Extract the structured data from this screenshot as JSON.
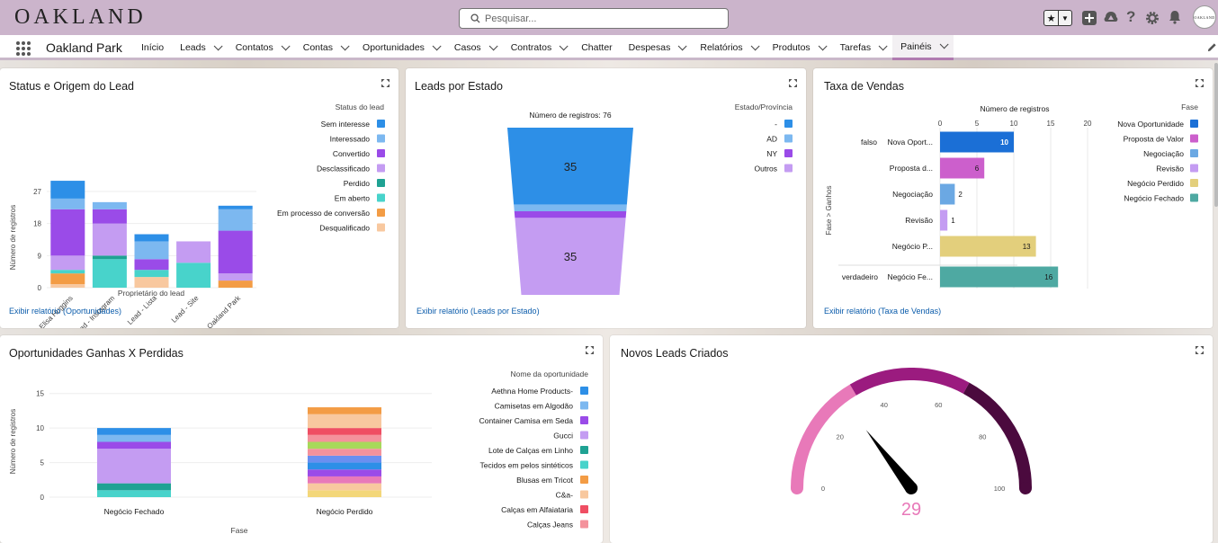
{
  "brand": {
    "logo_text": "OAKLAND",
    "avatar_text": "OAKLAND"
  },
  "search": {
    "placeholder": "Pesquisar..."
  },
  "nav": {
    "app_name": "Oakland Park",
    "items": [
      {
        "label": "Início",
        "chevron": false
      },
      {
        "label": "Leads",
        "chevron": true
      },
      {
        "label": "Contatos",
        "chevron": true
      },
      {
        "label": "Contas",
        "chevron": true
      },
      {
        "label": "Oportunidades",
        "chevron": true
      },
      {
        "label": "Casos",
        "chevron": true
      },
      {
        "label": "Contratos",
        "chevron": true
      },
      {
        "label": "Chatter",
        "chevron": false
      },
      {
        "label": "Despesas",
        "chevron": true
      },
      {
        "label": "Relatórios",
        "chevron": true
      },
      {
        "label": "Produtos",
        "chevron": true
      },
      {
        "label": "Tarefas",
        "chevron": true
      },
      {
        "label": "Painéis",
        "chevron": true,
        "active": true
      }
    ]
  },
  "colors": {
    "topbar": "#cbb4cb",
    "link": "#0b5cab",
    "gauge_pink": "#e879b9",
    "gauge_magenta": "#9b1b7f",
    "gauge_dark": "#4b0a3e"
  },
  "cards": {
    "status_origem": {
      "title": "Status e Origem do Lead",
      "link": "Exibir relatório (Oportunidades)",
      "chart_data": {
        "type": "bar",
        "stacked": true,
        "title": "Status e Origem do Lead",
        "xlabel": "Proprietário do lead",
        "ylabel": "Número de registros",
        "yticks": [
          0,
          9,
          18,
          27
        ],
        "ylim": [
          0,
          28
        ],
        "legend_title": "Status do lead",
        "legend_position": "right",
        "categories": [
          "Elisa Huggins",
          "Lead - Instagram",
          "Lead - Lista",
          "Lead - Site",
          "Oakland Park"
        ],
        "series": [
          {
            "name": "Sem interesse",
            "color": "#2d8fe7",
            "values": [
              5,
              0,
              2,
              0,
              1
            ]
          },
          {
            "name": "Interessado",
            "color": "#7cb8f0",
            "values": [
              3,
              2,
              5,
              0,
              6
            ]
          },
          {
            "name": "Convertido",
            "color": "#9a4be8",
            "values": [
              13,
              4,
              3,
              0,
              12
            ]
          },
          {
            "name": "Desclassificado",
            "color": "#c49cf2",
            "values": [
              4,
              9,
              0,
              6,
              2
            ]
          },
          {
            "name": "Perdido",
            "color": "#1fa293",
            "values": [
              0,
              1,
              0,
              0,
              0
            ]
          },
          {
            "name": "Em aberto",
            "color": "#48d3cb",
            "values": [
              1,
              8,
              2,
              7,
              0
            ]
          },
          {
            "name": "Em processo de conversão",
            "color": "#f39c45",
            "values": [
              3,
              0,
              0,
              0,
              2
            ]
          },
          {
            "name": "Desqualificado",
            "color": "#f8c89f",
            "values": [
              1,
              0,
              3,
              0,
              0
            ]
          }
        ]
      }
    },
    "leads_estado": {
      "title": "Leads por Estado",
      "link": "Exibir relatório (Leads por Estado)",
      "chart_data": {
        "type": "funnel",
        "title": "Número de registros: 76",
        "total": 76,
        "legend_title": "Estado/Província",
        "legend_position": "right",
        "series": [
          {
            "name": "-",
            "color": "#2d8fe7",
            "value": 35,
            "show_label": true
          },
          {
            "name": "AD",
            "color": "#7cb8f0",
            "value": 3,
            "show_label": false
          },
          {
            "name": "NY",
            "color": "#9a4be8",
            "value": 3,
            "show_label": false
          },
          {
            "name": "Outros",
            "color": "#c49cf2",
            "value": 35,
            "show_label": true
          }
        ]
      }
    },
    "taxa_vendas": {
      "title": "Taxa de Vendas",
      "link": "Exibir relatório (Taxa de Vendas)",
      "chart_data": {
        "type": "bar",
        "orientation": "horizontal",
        "xlabel": "Número de registros",
        "ylabel": "Fase > Ganhos",
        "xticks": [
          0,
          5,
          10,
          15,
          20
        ],
        "xlim": [
          0,
          20
        ],
        "legend_title": "Fase",
        "legend_position": "right",
        "groups": [
          {
            "name": "falso",
            "rows": [
              {
                "label": "Nova Oport...",
                "value": 10,
                "color": "#1b6fd6"
              },
              {
                "label": "Proposta d...",
                "value": 6,
                "color": "#cc5fcc"
              },
              {
                "label": "Negociação",
                "value": 2,
                "color": "#6ba8e3"
              },
              {
                "label": "Revisão",
                "value": 1,
                "color": "#c49cf2"
              },
              {
                "label": "Negócio P...",
                "value": 13,
                "color": "#e3cf7c"
              }
            ]
          },
          {
            "name": "verdadeiro",
            "rows": [
              {
                "label": "Negócio Fe...",
                "value": 16,
                "color": "#4ea9a2"
              }
            ]
          }
        ],
        "legend": [
          {
            "name": "Nova Oportunidade",
            "color": "#1b6fd6"
          },
          {
            "name": "Proposta de Valor",
            "color": "#cc5fcc"
          },
          {
            "name": "Negociação",
            "color": "#6ba8e3"
          },
          {
            "name": "Revisão",
            "color": "#c49cf2"
          },
          {
            "name": "Negócio Perdido",
            "color": "#e3cf7c"
          },
          {
            "name": "Negócio Fechado",
            "color": "#4ea9a2"
          }
        ]
      }
    },
    "ganhas_perdidas": {
      "title": "Oportunidades Ganhas X Perdidas",
      "chart_data": {
        "type": "bar",
        "stacked": true,
        "xlabel": "Fase",
        "ylabel": "Número de registros",
        "yticks": [
          0,
          5,
          10,
          15
        ],
        "ylim": [
          0,
          16
        ],
        "categories": [
          "Negócio Fechado",
          "Negócio Perdido"
        ],
        "legend_title": "Nome da oportunidade",
        "legend_position": "right",
        "legend": [
          {
            "name": "Aethna Home Products-",
            "color": "#2d8fe7"
          },
          {
            "name": "Camisetas em Algodão",
            "color": "#7cb8f0"
          },
          {
            "name": "Container Camisa em Seda",
            "color": "#9a4be8"
          },
          {
            "name": "Gucci",
            "color": "#c49cf2"
          },
          {
            "name": "Lote de Calças em Linho",
            "color": "#1fa293"
          },
          {
            "name": "Tecidos em pelos sintéticos",
            "color": "#48d3cb"
          },
          {
            "name": "Blusas em Tricot",
            "color": "#f39c45"
          },
          {
            "name": "C&a-",
            "color": "#f8c89f"
          },
          {
            "name": "Calças em Alfaiataria",
            "color": "#ef4e63"
          },
          {
            "name": "Calças Jeans",
            "color": "#f4929c"
          }
        ],
        "stacks": [
          {
            "category": "Negócio Fechado",
            "segments": [
              {
                "color": "#48d3cb",
                "value": 1
              },
              {
                "color": "#1fa293",
                "value": 1
              },
              {
                "color": "#c49cf2",
                "value": 5
              },
              {
                "color": "#9a4be8",
                "value": 1
              },
              {
                "color": "#7cb8f0",
                "value": 1
              },
              {
                "color": "#2d8fe7",
                "value": 1
              }
            ]
          },
          {
            "category": "Negócio Perdido",
            "segments": [
              {
                "color": "#f3d77a",
                "value": 1
              },
              {
                "color": "#f8c89f",
                "value": 1
              },
              {
                "color": "#e879b9",
                "value": 1
              },
              {
                "color": "#9a4be8",
                "value": 1
              },
              {
                "color": "#2d8fe7",
                "value": 1
              },
              {
                "color": "#6a8ff0",
                "value": 1
              },
              {
                "color": "#f4929c",
                "value": 1
              },
              {
                "color": "#a7d95a",
                "value": 1
              },
              {
                "color": "#f4929c",
                "value": 1
              },
              {
                "color": "#ef4e63",
                "value": 1
              },
              {
                "color": "#f8c89f",
                "value": 2
              },
              {
                "color": "#f39c45",
                "value": 1
              }
            ]
          }
        ]
      }
    },
    "novos_leads": {
      "title": "Novos Leads Criados",
      "chart_data": {
        "type": "gauge",
        "value": 29,
        "min": 0,
        "max": 100,
        "ticks": [
          0,
          20,
          40,
          60,
          80,
          100
        ],
        "bands": [
          {
            "from": 0,
            "to": 33,
            "color": "#e879b9"
          },
          {
            "from": 33,
            "to": 66,
            "color": "#9b1b7f"
          },
          {
            "from": 66,
            "to": 100,
            "color": "#4b0a3e"
          }
        ]
      }
    }
  }
}
